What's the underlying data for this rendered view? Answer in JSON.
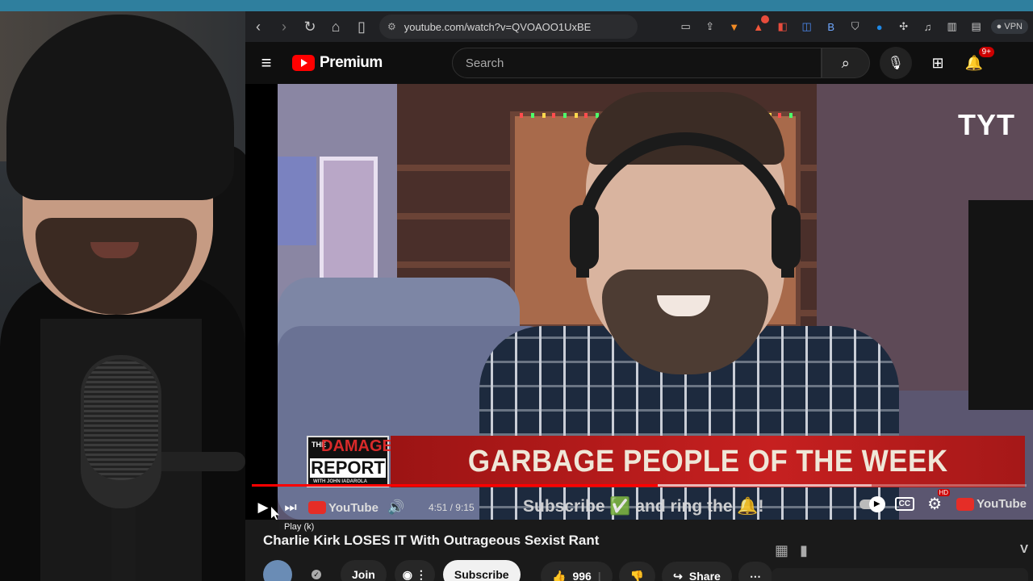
{
  "browser": {
    "url": "youtube.com/watch?v=QVOAOO1UxBE",
    "vpn_label": "VPN",
    "back_icon": "chevron-left-icon",
    "forward_icon": "chevron-right-icon",
    "reload_icon": "reload-icon",
    "home_icon": "home-icon",
    "bookmark_icon": "bookmark-icon"
  },
  "youtube_header": {
    "logo_text": "Premium",
    "search_placeholder": "Search",
    "notification_badge": "9+"
  },
  "video": {
    "watermark": "TYT",
    "lower_third": {
      "show_the": "THE",
      "show_damage": "DAMAGE",
      "show_report": "REPORT",
      "show_sub": "WITH JOHN IADAROLA",
      "headline": "GARBAGE PEOPLE OF THE WEEK"
    },
    "ticker": "Subscribe ✅ and ring the 🔔!",
    "player": {
      "current_time": "4:51",
      "duration": "9:15",
      "time_display": "4:51 / 9:15",
      "played_fraction": 0.524,
      "loaded_fraction": 0.8,
      "yt_mark": "YouTube",
      "yt_mark_right": "YouTube",
      "tooltip": "Play (k)",
      "cc_label": "CC",
      "hd_badge": "HD"
    }
  },
  "below": {
    "title": "Charlie Kirk LOSES IT With Outrageous Sexist Rant",
    "join_label": "Join",
    "subscribe_label": "Subscribe",
    "like_count": "996",
    "share_label": "Share",
    "more_label": "⋯",
    "edge_text": "V"
  },
  "colors": {
    "youtube_red": "#ff0000",
    "lower_third_red": "#c62020",
    "browser_chrome": "#202124",
    "page_bg": "#0f0f0f"
  }
}
